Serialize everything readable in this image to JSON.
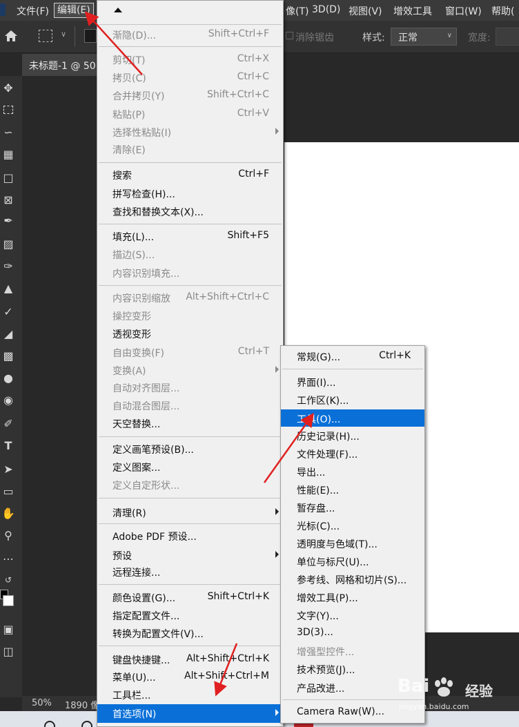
{
  "menubar": {
    "items": [
      "文件(F)",
      "编辑(E)",
      "像(T)",
      "3D(D)",
      "视图(V)",
      "增效工具",
      "窗口(W)",
      "帮助("
    ]
  },
  "options_bar": {
    "antialias_label": "消除锯齿",
    "style_label": "样式:",
    "style_value": "正常",
    "width_label": "宽度:"
  },
  "document": {
    "tab_title": "未标题-1 @ 50",
    "zoom": "50%",
    "size_info": "1890 像"
  },
  "edit_menu": {
    "items": [
      {
        "label": "渐隐(D)...",
        "shortcut": "Shift+Ctrl+F",
        "disabled": true
      },
      {
        "label": "剪切(T)",
        "shortcut": "Ctrl+X",
        "disabled": true
      },
      {
        "label": "拷贝(C)",
        "shortcut": "Ctrl+C",
        "disabled": true
      },
      {
        "label": "合并拷贝(Y)",
        "shortcut": "Shift+Ctrl+C",
        "disabled": true
      },
      {
        "label": "粘贴(P)",
        "shortcut": "Ctrl+V",
        "disabled": true
      },
      {
        "label": "选择性粘贴(I)",
        "shortcut": "",
        "disabled": true
      },
      {
        "label": "清除(E)",
        "shortcut": "",
        "disabled": true
      },
      {
        "label": "搜索",
        "shortcut": "Ctrl+F",
        "disabled": false
      },
      {
        "label": "拼写检查(H)...",
        "shortcut": "",
        "disabled": false
      },
      {
        "label": "查找和替换文本(X)...",
        "shortcut": "",
        "disabled": false
      },
      {
        "label": "填充(L)...",
        "shortcut": "Shift+F5",
        "disabled": false
      },
      {
        "label": "描边(S)...",
        "shortcut": "",
        "disabled": true
      },
      {
        "label": "内容识别填充...",
        "shortcut": "",
        "disabled": true
      },
      {
        "label": "内容识别缩放",
        "shortcut": "Alt+Shift+Ctrl+C",
        "disabled": true
      },
      {
        "label": "操控变形",
        "shortcut": "",
        "disabled": true
      },
      {
        "label": "透视变形",
        "shortcut": "",
        "disabled": false
      },
      {
        "label": "自由变换(F)",
        "shortcut": "Ctrl+T",
        "disabled": true
      },
      {
        "label": "变换(A)",
        "shortcut": "",
        "disabled": true
      },
      {
        "label": "自动对齐图层...",
        "shortcut": "",
        "disabled": true
      },
      {
        "label": "自动混合图层...",
        "shortcut": "",
        "disabled": true
      },
      {
        "label": "天空替换...",
        "shortcut": "",
        "disabled": false
      },
      {
        "label": "定义画笔预设(B)...",
        "shortcut": "",
        "disabled": false
      },
      {
        "label": "定义图案...",
        "shortcut": "",
        "disabled": false
      },
      {
        "label": "定义自定形状...",
        "shortcut": "",
        "disabled": true
      },
      {
        "label": "清理(R)",
        "shortcut": "",
        "disabled": false
      },
      {
        "label": "Adobe PDF 预设...",
        "shortcut": "",
        "disabled": false
      },
      {
        "label": "预设",
        "shortcut": "",
        "disabled": false
      },
      {
        "label": "远程连接...",
        "shortcut": "",
        "disabled": false
      },
      {
        "label": "颜色设置(G)...",
        "shortcut": "Shift+Ctrl+K",
        "disabled": false
      },
      {
        "label": "指定配置文件...",
        "shortcut": "",
        "disabled": false
      },
      {
        "label": "转换为配置文件(V)...",
        "shortcut": "",
        "disabled": false
      },
      {
        "label": "键盘快捷键...",
        "shortcut": "Alt+Shift+Ctrl+K",
        "disabled": false
      },
      {
        "label": "菜单(U)...",
        "shortcut": "Alt+Shift+Ctrl+M",
        "disabled": false
      },
      {
        "label": "工具栏...",
        "shortcut": "",
        "disabled": false
      },
      {
        "label": "首选项(N)",
        "shortcut": "",
        "disabled": false
      }
    ]
  },
  "preferences_menu": {
    "items": [
      {
        "label": "常规(G)...",
        "shortcut": "Ctrl+K",
        "disabled": false
      },
      {
        "label": "界面(I)...",
        "shortcut": "",
        "disabled": false
      },
      {
        "label": "工作区(K)...",
        "shortcut": "",
        "disabled": false
      },
      {
        "label": "工具(O)...",
        "shortcut": "",
        "disabled": false
      },
      {
        "label": "历史记录(H)...",
        "shortcut": "",
        "disabled": false
      },
      {
        "label": "文件处理(F)...",
        "shortcut": "",
        "disabled": false
      },
      {
        "label": "导出...",
        "shortcut": "",
        "disabled": false
      },
      {
        "label": "性能(E)...",
        "shortcut": "",
        "disabled": false
      },
      {
        "label": "暂存盘...",
        "shortcut": "",
        "disabled": false
      },
      {
        "label": "光标(C)...",
        "shortcut": "",
        "disabled": false
      },
      {
        "label": "透明度与色域(T)...",
        "shortcut": "",
        "disabled": false
      },
      {
        "label": "单位与标尺(U)...",
        "shortcut": "",
        "disabled": false
      },
      {
        "label": "参考线、网格和切片(S)...",
        "shortcut": "",
        "disabled": false
      },
      {
        "label": "增效工具(P)...",
        "shortcut": "",
        "disabled": false
      },
      {
        "label": "文字(Y)...",
        "shortcut": "",
        "disabled": false
      },
      {
        "label": "3D(3)...",
        "shortcut": "",
        "disabled": false
      },
      {
        "label": "增强型控件...",
        "shortcut": "",
        "disabled": true
      },
      {
        "label": "技术预览(J)...",
        "shortcut": "",
        "disabled": false
      },
      {
        "label": "产品改进...",
        "shortcut": "",
        "disabled": false
      },
      {
        "label": "Camera Raw(W)...",
        "shortcut": "",
        "disabled": false
      }
    ]
  },
  "watermark": {
    "brand": "Bai",
    "brand2": "经验",
    "url": "jingyan.baidu.com"
  },
  "colors": {
    "highlight": "#0a70d8",
    "annotation_arrow": "#e02020"
  }
}
